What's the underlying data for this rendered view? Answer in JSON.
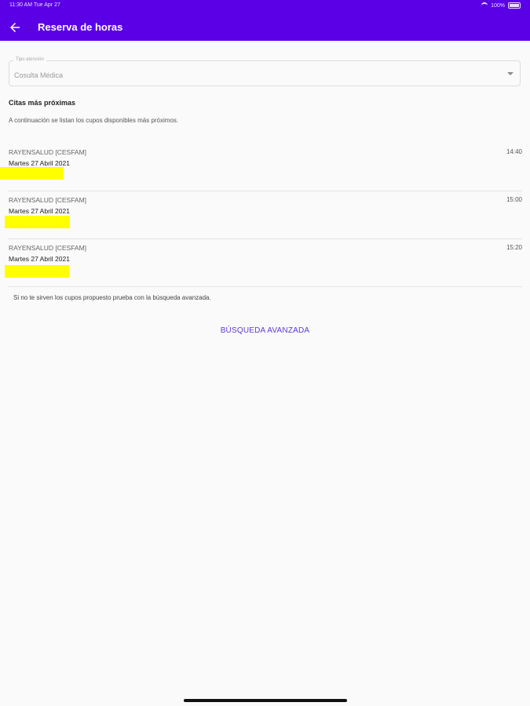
{
  "status_bar": {
    "time": "11:30 AM",
    "date": "Tue Apr 27",
    "battery": "100%"
  },
  "header": {
    "title": "Reserva de horas"
  },
  "attention_type": {
    "label": "Tipo atención",
    "value": "Cosulta Médica"
  },
  "upcoming": {
    "title": "Citas más próximas",
    "description": "A continuación se listan los cupos disponibles más próximos."
  },
  "slots": [
    {
      "provider": "RAYENSALUD [CESFAM]",
      "date": "Martes 27 Abril 2021",
      "time": "14:40"
    },
    {
      "provider": "RAYENSALUD [CESFAM]",
      "date": "Martes 27 Abril 2021",
      "time": "15:00"
    },
    {
      "provider": "RAYENSALUD [CESFAM]",
      "date": "Martes 27 Abril 2021",
      "time": "15:20"
    }
  ],
  "hint": "Si no te sirven los cupos propuesto prueba con la búsqueda avanzada.",
  "advanced_search_label": "BÚSQUEDA AVANZADA"
}
